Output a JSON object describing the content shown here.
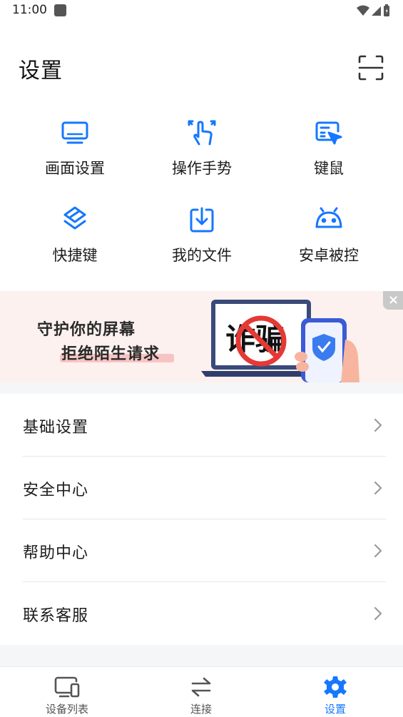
{
  "status_bar": {
    "time": "11:00"
  },
  "header": {
    "title": "设置",
    "scan_icon": "scan-frame-icon"
  },
  "quick_actions": [
    {
      "label": "画面设置",
      "icon": "monitor-icon"
    },
    {
      "label": "操作手势",
      "icon": "gesture-icon"
    },
    {
      "label": "键鼠",
      "icon": "keyboard-mouse-icon"
    },
    {
      "label": "快捷键",
      "icon": "shortcut-icon"
    },
    {
      "label": "我的文件",
      "icon": "download-file-icon"
    },
    {
      "label": "安卓被控",
      "icon": "android-icon"
    }
  ],
  "banner": {
    "line1": "守护你的屏幕",
    "line2": "拒绝陌生请求",
    "graphic_text": "诈骗",
    "close_label": "×"
  },
  "settings_list": [
    {
      "label": "基础设置"
    },
    {
      "label": "安全中心"
    },
    {
      "label": "帮助中心"
    },
    {
      "label": "联系客服"
    }
  ],
  "bottom_nav": [
    {
      "label": "设备列表",
      "icon": "devices-icon",
      "active": false
    },
    {
      "label": "连接",
      "icon": "swap-arrows-icon",
      "active": false
    },
    {
      "label": "设置",
      "icon": "gear-icon",
      "active": true
    }
  ],
  "colors": {
    "accent": "#1677ff",
    "banner_bg": "#fcf1ee",
    "band_bg": "#f5f6f8"
  }
}
